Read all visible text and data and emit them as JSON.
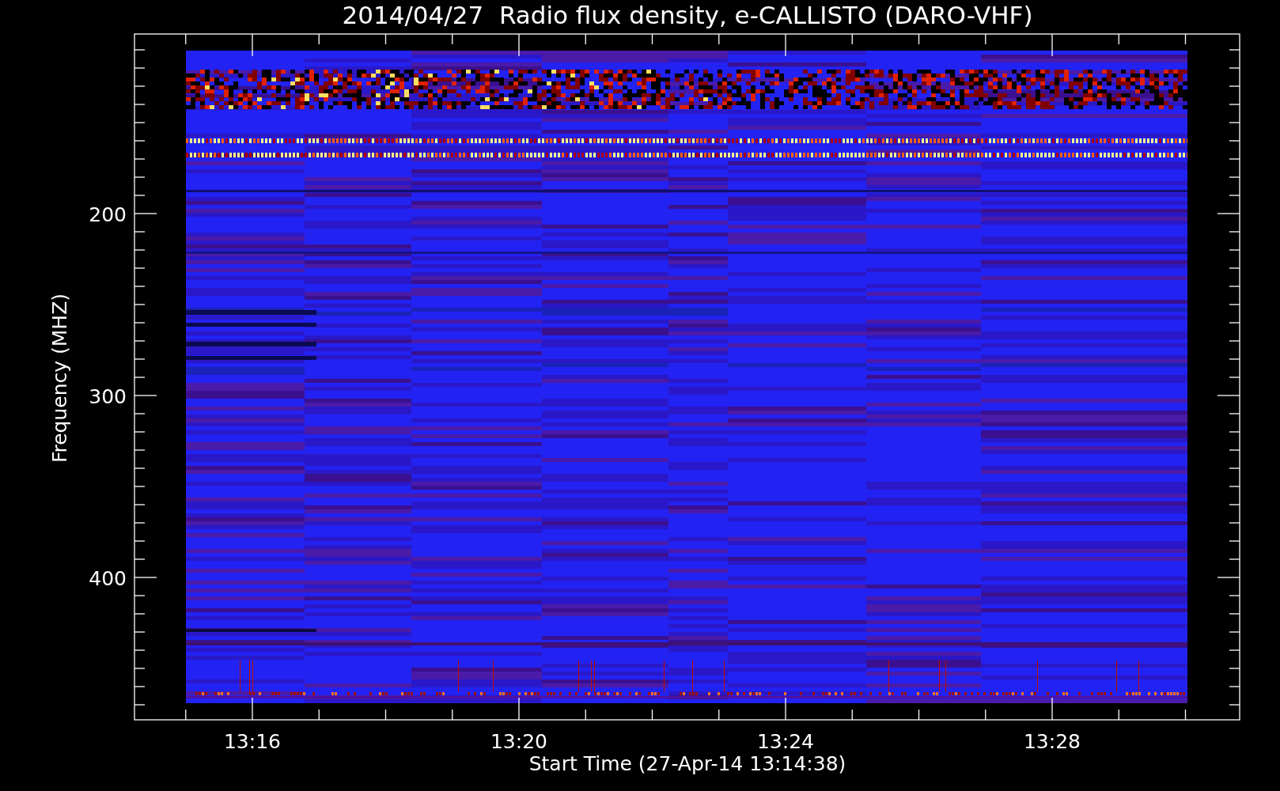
{
  "title": "2014/04/27  Radio flux density, e-CALLISTO (DARO-VHF)",
  "y_axis": {
    "label": "Frequency (MHZ)",
    "tick_labels": [
      "200",
      "300",
      "400"
    ]
  },
  "x_axis": {
    "label": "Start Time (27-Apr-14 13:14:38)",
    "tick_labels": [
      "13:16",
      "13:20",
      "13:24",
      "13:28"
    ]
  }
}
